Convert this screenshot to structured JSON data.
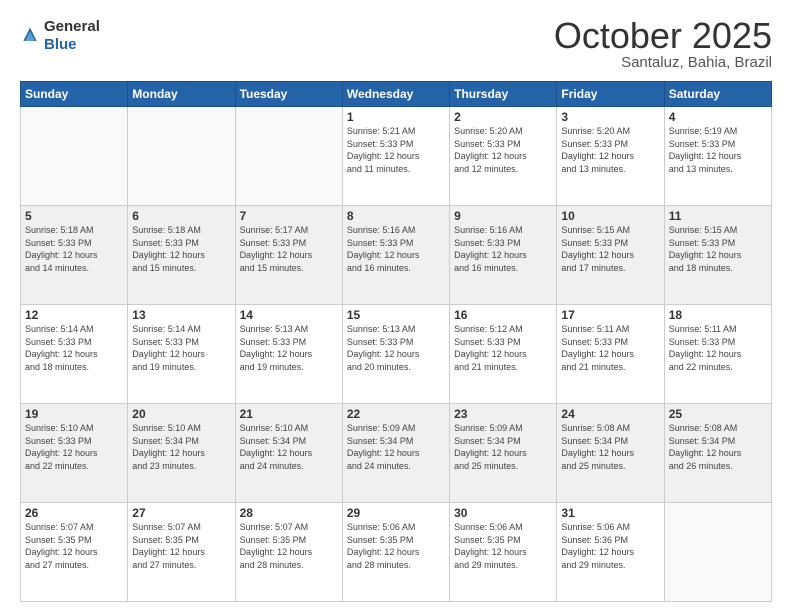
{
  "header": {
    "logo_general": "General",
    "logo_blue": "Blue",
    "month": "October 2025",
    "location": "Santaluz, Bahia, Brazil"
  },
  "weekdays": [
    "Sunday",
    "Monday",
    "Tuesday",
    "Wednesday",
    "Thursday",
    "Friday",
    "Saturday"
  ],
  "weeks": [
    [
      {
        "day": "",
        "info": ""
      },
      {
        "day": "",
        "info": ""
      },
      {
        "day": "",
        "info": ""
      },
      {
        "day": "1",
        "info": "Sunrise: 5:21 AM\nSunset: 5:33 PM\nDaylight: 12 hours\nand 11 minutes."
      },
      {
        "day": "2",
        "info": "Sunrise: 5:20 AM\nSunset: 5:33 PM\nDaylight: 12 hours\nand 12 minutes."
      },
      {
        "day": "3",
        "info": "Sunrise: 5:20 AM\nSunset: 5:33 PM\nDaylight: 12 hours\nand 13 minutes."
      },
      {
        "day": "4",
        "info": "Sunrise: 5:19 AM\nSunset: 5:33 PM\nDaylight: 12 hours\nand 13 minutes."
      }
    ],
    [
      {
        "day": "5",
        "info": "Sunrise: 5:18 AM\nSunset: 5:33 PM\nDaylight: 12 hours\nand 14 minutes."
      },
      {
        "day": "6",
        "info": "Sunrise: 5:18 AM\nSunset: 5:33 PM\nDaylight: 12 hours\nand 15 minutes."
      },
      {
        "day": "7",
        "info": "Sunrise: 5:17 AM\nSunset: 5:33 PM\nDaylight: 12 hours\nand 15 minutes."
      },
      {
        "day": "8",
        "info": "Sunrise: 5:16 AM\nSunset: 5:33 PM\nDaylight: 12 hours\nand 16 minutes."
      },
      {
        "day": "9",
        "info": "Sunrise: 5:16 AM\nSunset: 5:33 PM\nDaylight: 12 hours\nand 16 minutes."
      },
      {
        "day": "10",
        "info": "Sunrise: 5:15 AM\nSunset: 5:33 PM\nDaylight: 12 hours\nand 17 minutes."
      },
      {
        "day": "11",
        "info": "Sunrise: 5:15 AM\nSunset: 5:33 PM\nDaylight: 12 hours\nand 18 minutes."
      }
    ],
    [
      {
        "day": "12",
        "info": "Sunrise: 5:14 AM\nSunset: 5:33 PM\nDaylight: 12 hours\nand 18 minutes."
      },
      {
        "day": "13",
        "info": "Sunrise: 5:14 AM\nSunset: 5:33 PM\nDaylight: 12 hours\nand 19 minutes."
      },
      {
        "day": "14",
        "info": "Sunrise: 5:13 AM\nSunset: 5:33 PM\nDaylight: 12 hours\nand 19 minutes."
      },
      {
        "day": "15",
        "info": "Sunrise: 5:13 AM\nSunset: 5:33 PM\nDaylight: 12 hours\nand 20 minutes."
      },
      {
        "day": "16",
        "info": "Sunrise: 5:12 AM\nSunset: 5:33 PM\nDaylight: 12 hours\nand 21 minutes."
      },
      {
        "day": "17",
        "info": "Sunrise: 5:11 AM\nSunset: 5:33 PM\nDaylight: 12 hours\nand 21 minutes."
      },
      {
        "day": "18",
        "info": "Sunrise: 5:11 AM\nSunset: 5:33 PM\nDaylight: 12 hours\nand 22 minutes."
      }
    ],
    [
      {
        "day": "19",
        "info": "Sunrise: 5:10 AM\nSunset: 5:33 PM\nDaylight: 12 hours\nand 22 minutes."
      },
      {
        "day": "20",
        "info": "Sunrise: 5:10 AM\nSunset: 5:34 PM\nDaylight: 12 hours\nand 23 minutes."
      },
      {
        "day": "21",
        "info": "Sunrise: 5:10 AM\nSunset: 5:34 PM\nDaylight: 12 hours\nand 24 minutes."
      },
      {
        "day": "22",
        "info": "Sunrise: 5:09 AM\nSunset: 5:34 PM\nDaylight: 12 hours\nand 24 minutes."
      },
      {
        "day": "23",
        "info": "Sunrise: 5:09 AM\nSunset: 5:34 PM\nDaylight: 12 hours\nand 25 minutes."
      },
      {
        "day": "24",
        "info": "Sunrise: 5:08 AM\nSunset: 5:34 PM\nDaylight: 12 hours\nand 25 minutes."
      },
      {
        "day": "25",
        "info": "Sunrise: 5:08 AM\nSunset: 5:34 PM\nDaylight: 12 hours\nand 26 minutes."
      }
    ],
    [
      {
        "day": "26",
        "info": "Sunrise: 5:07 AM\nSunset: 5:35 PM\nDaylight: 12 hours\nand 27 minutes."
      },
      {
        "day": "27",
        "info": "Sunrise: 5:07 AM\nSunset: 5:35 PM\nDaylight: 12 hours\nand 27 minutes."
      },
      {
        "day": "28",
        "info": "Sunrise: 5:07 AM\nSunset: 5:35 PM\nDaylight: 12 hours\nand 28 minutes."
      },
      {
        "day": "29",
        "info": "Sunrise: 5:06 AM\nSunset: 5:35 PM\nDaylight: 12 hours\nand 28 minutes."
      },
      {
        "day": "30",
        "info": "Sunrise: 5:06 AM\nSunset: 5:35 PM\nDaylight: 12 hours\nand 29 minutes."
      },
      {
        "day": "31",
        "info": "Sunrise: 5:06 AM\nSunset: 5:36 PM\nDaylight: 12 hours\nand 29 minutes."
      },
      {
        "day": "",
        "info": ""
      }
    ]
  ]
}
